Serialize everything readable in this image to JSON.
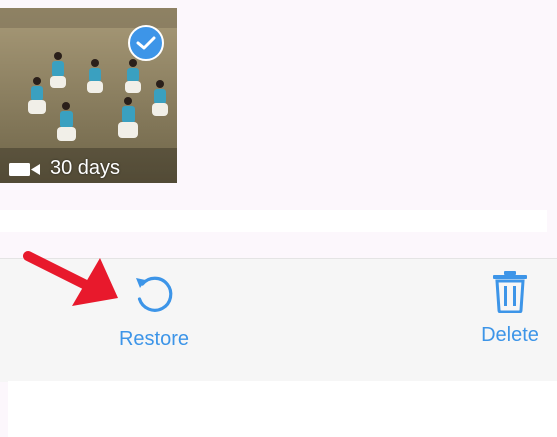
{
  "media_item": {
    "days_left": "30 days",
    "type_icon": "video-camera-icon",
    "selected": true,
    "selected_icon": "checkmark-icon"
  },
  "toolbar": {
    "restore": {
      "label": "Restore",
      "icon": "restore-icon"
    },
    "delete": {
      "label": "Delete",
      "icon": "trash-icon"
    }
  },
  "colors": {
    "accent": "#3d95e8",
    "annotation_arrow": "#e8192c",
    "background": "#fcf7fc",
    "toolbar": "#f6f6f6"
  }
}
